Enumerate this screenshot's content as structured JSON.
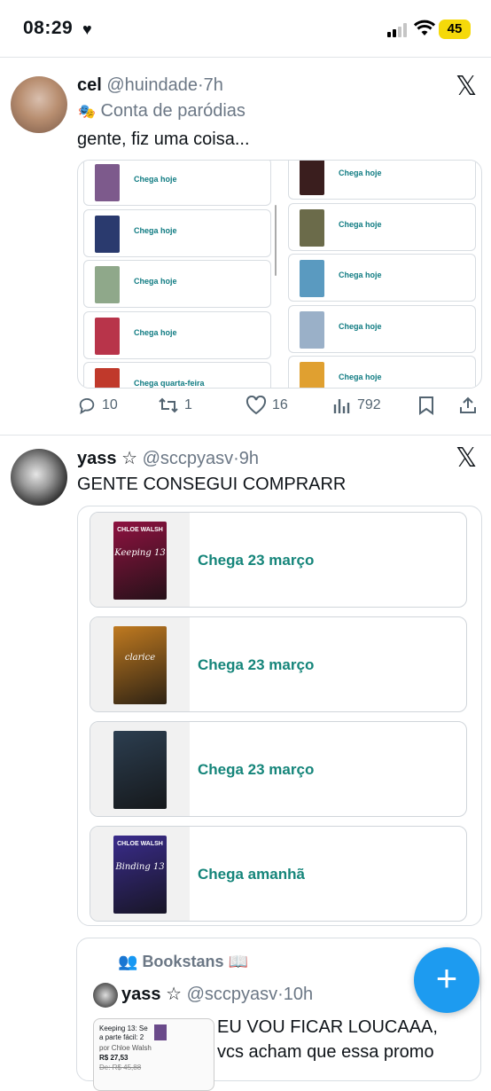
{
  "status": {
    "time": "08:29",
    "battery": "45"
  },
  "post1": {
    "name": "cel",
    "handle": "@huindade",
    "dot": "·",
    "age": "7h",
    "badge": "Conta de paródias",
    "text": "gente, fiz uma coisa...",
    "cards_left": [
      {
        "label": "Chega hoje",
        "color": "#7d5a8c"
      },
      {
        "label": "Chega hoje",
        "color": "#2a3a6e"
      },
      {
        "label": "Chega hoje",
        "color": "#8fa88a"
      },
      {
        "label": "Chega hoje",
        "color": "#b8344a"
      },
      {
        "label": "Chega quarta-feira",
        "color": "#c0392b"
      }
    ],
    "cards_right": [
      {
        "label": "Chega hoje",
        "color": "#3a1e1e"
      },
      {
        "label": "Chega hoje",
        "color": "#6b6b4a"
      },
      {
        "label": "Chega hoje",
        "color": "#5a9ac0"
      },
      {
        "label": "Chega hoje",
        "color": "#9ab0c8"
      },
      {
        "label": "Chega hoje",
        "color": "#e0a030"
      }
    ],
    "replies": "10",
    "reposts": "1",
    "likes": "16",
    "views": "792"
  },
  "post2": {
    "name": "yass",
    "star": "☆",
    "handle": "@sccpyasv",
    "dot": "·",
    "age": "9h",
    "text": "GENTE CONSEGUI COMPRARR",
    "cards": [
      {
        "label": "Chega 23 março",
        "title": "Keeping 13",
        "author": "CHLOE WALSH",
        "color": "#8e1240"
      },
      {
        "label": "Chega 23 março",
        "title": "clarice",
        "author": "",
        "color": "#c07a20"
      },
      {
        "label": "Chega 23 março",
        "title": "",
        "author": "",
        "color": "#2c3e50"
      },
      {
        "label": "Chega amanhã",
        "title": "Binding 13",
        "author": "CHLOE WALSH",
        "color": "#3a2c8c"
      }
    ]
  },
  "quote": {
    "community": "Bookstans 📖",
    "name": "yass",
    "star": "☆",
    "handle": "@sccpyasv",
    "dot": "·",
    "age": "10h",
    "line1": "EU VOU FICAR LOUCAAA,",
    "line2": "vcs acham que essa promo",
    "thumb_title": "Keeping 13: Se a parte fácil: 2",
    "thumb_author": "por Chloe Walsh",
    "thumb_price": "R$ 27,53",
    "thumb_old": "De: R$ 45,88"
  },
  "colors": {
    "accent": "#1d9bf0",
    "delivery_green": "#15857a"
  }
}
